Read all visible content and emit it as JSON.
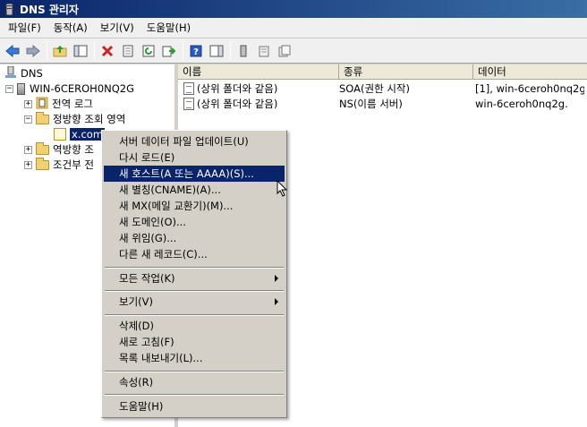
{
  "window": {
    "title": "DNS 관리자"
  },
  "menubar": [
    "파일(F)",
    "동작(A)",
    "보기(V)",
    "도움말(H)"
  ],
  "toolbar": {
    "buttons": [
      "back-arrow-icon",
      "forward-arrow-icon",
      "up-folder-icon",
      "show-hide-tree-icon",
      "delete-icon",
      "properties-icon",
      "refresh-icon",
      "export-list-icon",
      "help-icon",
      "show-hide-action-icon",
      "server-icon",
      "zone-properties-icon",
      "zone-records-icon"
    ]
  },
  "tree": {
    "root": "DNS",
    "server": "WIN-6CEROH0NQ2G",
    "global_logs": "전역 로그",
    "forward_zones": "정방향 조회 영역",
    "zone": "x.com",
    "reverse_zones": "역방향 조",
    "conditional": "조건부 전",
    "expander_plus": "+",
    "expander_minus": "−"
  },
  "list": {
    "columns": [
      "이름",
      "종류",
      "데이터"
    ],
    "rows": [
      {
        "name": "(상위 폴더와 같음)",
        "type": "SOA(권한 시작)",
        "data": "[1], win-6ceroh0nq2g."
      },
      {
        "name": "(상위 폴더와 같음)",
        "type": "NS(이름 서버)",
        "data": "win-6ceroh0nq2g."
      }
    ]
  },
  "context_menu": {
    "items": [
      "서버 데이터 파일 업데이트(U)",
      "다시 로드(E)",
      "새 호스트(A 또는 AAAA)(S)...",
      "새 별칭(CNAME)(A)...",
      "새 MX(메일 교환기)(M)...",
      "새 도메인(O)...",
      "새 위임(G)...",
      "다른 새 레코드(C)...",
      "모든 작업(K)",
      "보기(V)",
      "삭제(D)",
      "새로 고침(F)",
      "목록 내보내기(L)...",
      "속성(R)",
      "도움말(H)"
    ],
    "highlighted_index": 2
  },
  "colors": {
    "selection": "#0a246a",
    "titlebar_start": "#0a246a",
    "delete_red": "#d02020"
  }
}
